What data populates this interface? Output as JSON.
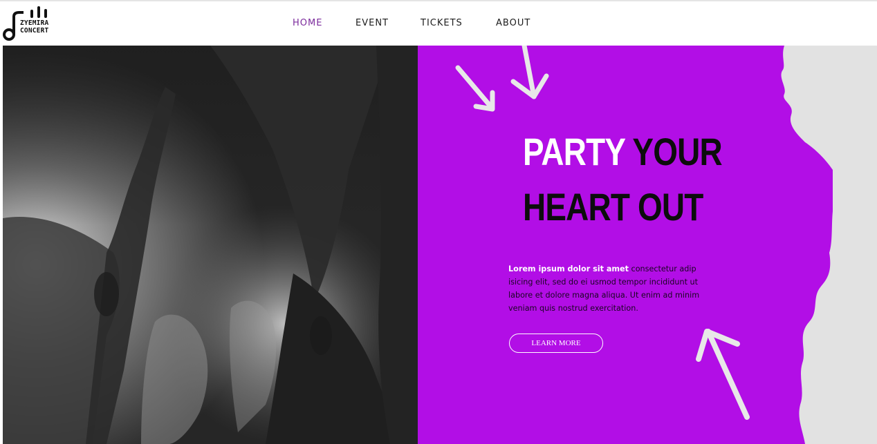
{
  "brand": {
    "line1": "ZYEMIRA",
    "line2": "CONCERT"
  },
  "nav": {
    "items": [
      {
        "label": "HOME",
        "active": true
      },
      {
        "label": "EVENT",
        "active": false
      },
      {
        "label": "TICKETS",
        "active": false
      },
      {
        "label": "ABOUT",
        "active": false
      }
    ]
  },
  "hero": {
    "headline_part1": "PARTY",
    "headline_part2": " YOUR",
    "headline_line2": "HEART OUT",
    "body_lead": "Lorem ipsum dolor sit amet",
    "body_rest": " consectetur adip isicing elit, sed do ei usmod tempor incididunt ut labore et dolore magna aliqua. Ut enim ad minim veniam quis nostrud exercitation.",
    "cta_label": "LEARN MORE"
  },
  "colors": {
    "accent_purple": "#b20ee6",
    "nav_active": "#7b2a9c",
    "torn_paper": "#e2e2e2"
  }
}
